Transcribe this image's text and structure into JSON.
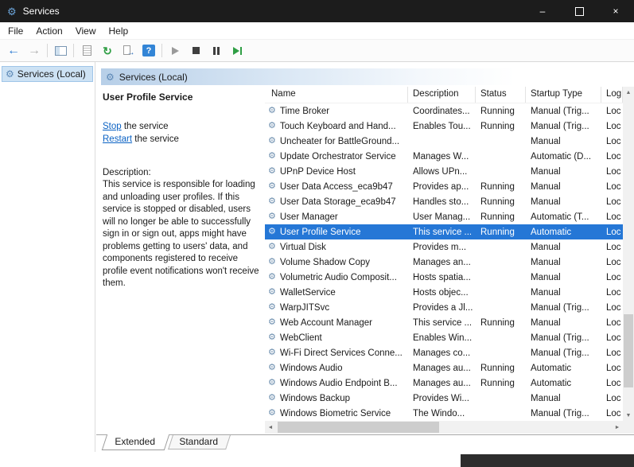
{
  "colors": {
    "selection": "#2577d6",
    "titlebar": "#1c1c1c",
    "link": "#0b62c4",
    "banner_gradient_start": "#b7cfe8"
  },
  "icons": {
    "gear_glyph": "⚙",
    "app": "gear",
    "tree_root": "gear",
    "service_row": "gear"
  },
  "window": {
    "title": "Services",
    "controls": {
      "minimize": "–",
      "close": "×"
    }
  },
  "menu": {
    "items": [
      "File",
      "Action",
      "View",
      "Help"
    ]
  },
  "toolbar": {
    "icons": [
      "back",
      "forward",
      "show-console-tree",
      "properties",
      "refresh",
      "export-list",
      "help",
      "start-service",
      "stop-service",
      "pause-service",
      "restart-service"
    ],
    "back_glyph": "←",
    "forward_glyph": "→",
    "refresh_glyph": "↻",
    "export_arrow_glyph": "→",
    "help_glyph": "?"
  },
  "tree": {
    "root_label": "Services (Local)"
  },
  "pane": {
    "banner": "Services (Local)",
    "service_title": "User Profile Service",
    "stop_link": "Stop",
    "stop_rest": " the service",
    "restart_link": "Restart",
    "restart_rest": " the service",
    "description_label": "Description:",
    "description": "This service is responsible for loading and unloading user profiles. If this service is stopped or disabled, users will no longer be able to successfully sign in or sign out, apps might have problems getting to users' data, and components registered to receive profile event notifications won't receive them."
  },
  "table": {
    "columns": [
      "Name",
      "Description",
      "Status",
      "Startup Type",
      "Log On As"
    ],
    "selected_index": 8,
    "rows": [
      {
        "name": "Time Broker",
        "description": "Coordinates...",
        "status": "Running",
        "startup_type": "Manual (Trig...",
        "log_on_as": "Loc"
      },
      {
        "name": "Touch Keyboard and Hand...",
        "description": "Enables Tou...",
        "status": "Running",
        "startup_type": "Manual (Trig...",
        "log_on_as": "Loc"
      },
      {
        "name": "Uncheater for BattleGround...",
        "description": "",
        "status": "",
        "startup_type": "Manual",
        "log_on_as": "Loc"
      },
      {
        "name": "Update Orchestrator Service",
        "description": "Manages W...",
        "status": "",
        "startup_type": "Automatic (D...",
        "log_on_as": "Loc"
      },
      {
        "name": "UPnP Device Host",
        "description": "Allows UPn...",
        "status": "",
        "startup_type": "Manual",
        "log_on_as": "Loc"
      },
      {
        "name": "User Data Access_eca9b47",
        "description": "Provides ap...",
        "status": "Running",
        "startup_type": "Manual",
        "log_on_as": "Loc"
      },
      {
        "name": "User Data Storage_eca9b47",
        "description": "Handles sto...",
        "status": "Running",
        "startup_type": "Manual",
        "log_on_as": "Loc"
      },
      {
        "name": "User Manager",
        "description": "User Manag...",
        "status": "Running",
        "startup_type": "Automatic (T...",
        "log_on_as": "Loc"
      },
      {
        "name": "User Profile Service",
        "description": "This service ...",
        "status": "Running",
        "startup_type": "Automatic",
        "log_on_as": "Loc"
      },
      {
        "name": "Virtual Disk",
        "description": "Provides m...",
        "status": "",
        "startup_type": "Manual",
        "log_on_as": "Loc"
      },
      {
        "name": "Volume Shadow Copy",
        "description": "Manages an...",
        "status": "",
        "startup_type": "Manual",
        "log_on_as": "Loc"
      },
      {
        "name": "Volumetric Audio Composit...",
        "description": "Hosts spatia...",
        "status": "",
        "startup_type": "Manual",
        "log_on_as": "Loc"
      },
      {
        "name": "WalletService",
        "description": "Hosts objec...",
        "status": "",
        "startup_type": "Manual",
        "log_on_as": "Loc"
      },
      {
        "name": "WarpJITSvc",
        "description": "Provides a Jl...",
        "status": "",
        "startup_type": "Manual (Trig...",
        "log_on_as": "Loc"
      },
      {
        "name": "Web Account Manager",
        "description": "This service ...",
        "status": "Running",
        "startup_type": "Manual",
        "log_on_as": "Loc"
      },
      {
        "name": "WebClient",
        "description": "Enables Win...",
        "status": "",
        "startup_type": "Manual (Trig...",
        "log_on_as": "Loc"
      },
      {
        "name": "Wi-Fi Direct Services Conne...",
        "description": "Manages co...",
        "status": "",
        "startup_type": "Manual (Trig...",
        "log_on_as": "Loc"
      },
      {
        "name": "Windows Audio",
        "description": "Manages au...",
        "status": "Running",
        "startup_type": "Automatic",
        "log_on_as": "Loc"
      },
      {
        "name": "Windows Audio Endpoint B...",
        "description": "Manages au...",
        "status": "Running",
        "startup_type": "Automatic",
        "log_on_as": "Loc"
      },
      {
        "name": "Windows Backup",
        "description": "Provides Wi...",
        "status": "",
        "startup_type": "Manual",
        "log_on_as": "Loc"
      },
      {
        "name": "Windows Biometric Service",
        "description": "The Windo...",
        "status": "",
        "startup_type": "Manual (Trig...",
        "log_on_as": "Loc"
      }
    ]
  },
  "tabs": {
    "extended": "Extended",
    "standard": "Standard"
  },
  "scrollbar": {
    "up": "▲",
    "down": "▼",
    "left": "◄",
    "right": "►"
  }
}
